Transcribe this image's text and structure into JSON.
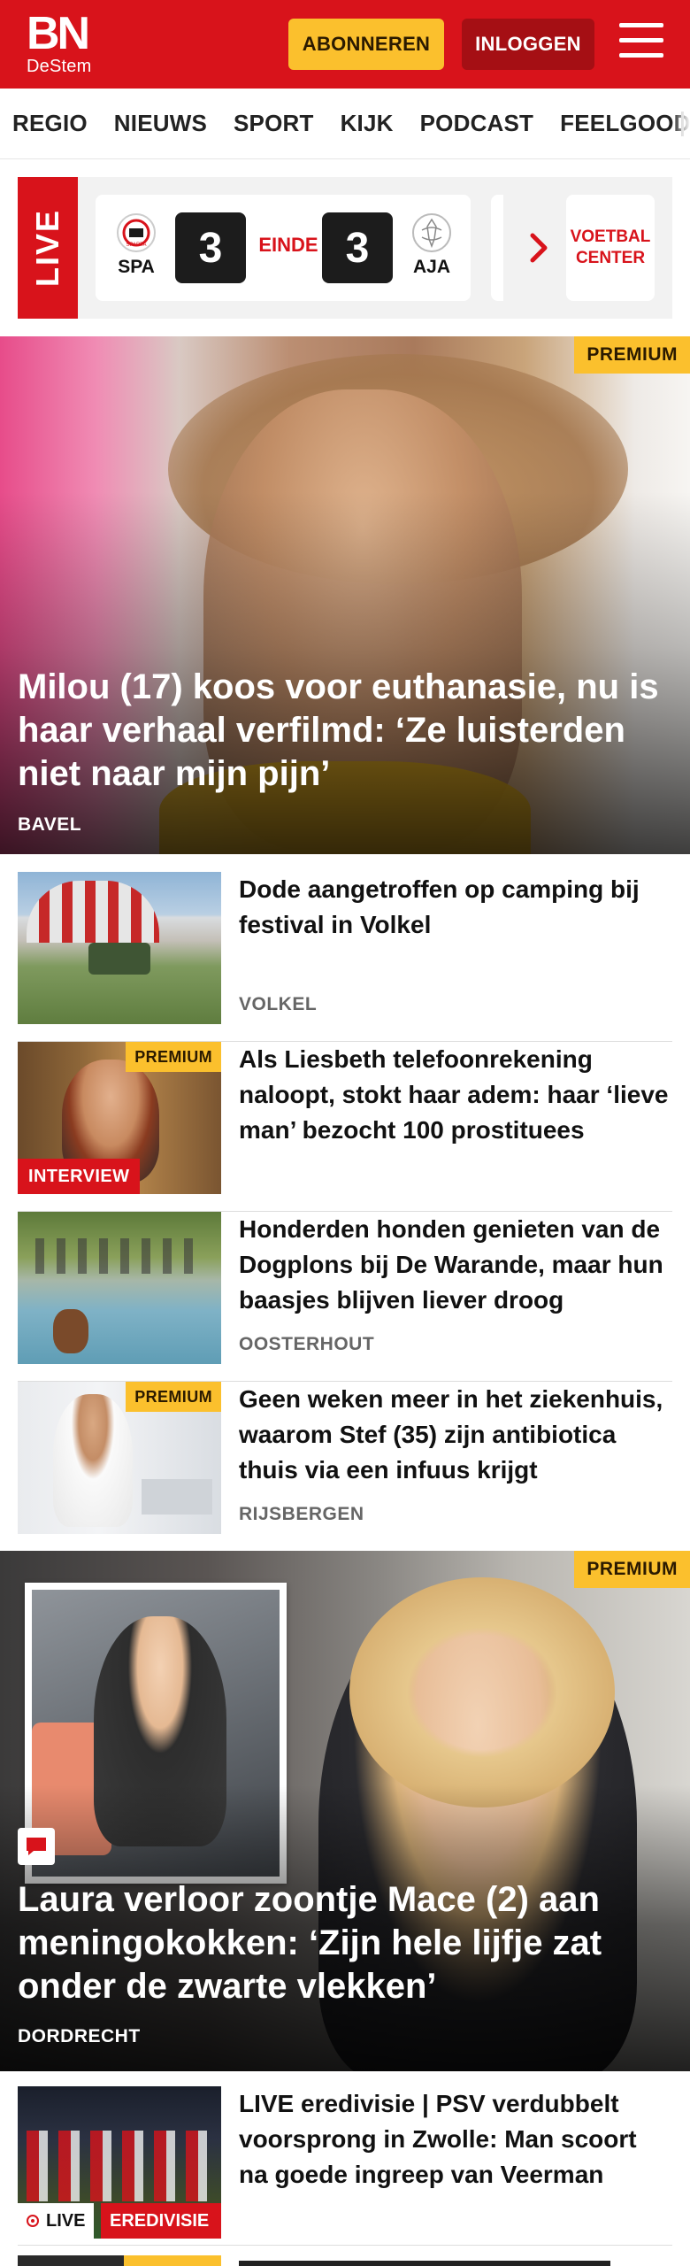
{
  "header": {
    "logo_main": "BN",
    "logo_sub": "DeStem",
    "subscribe_label": "ABONNEREN",
    "login_label": "INLOGGEN",
    "menu_icon": "hamburger-menu-icon",
    "colors": {
      "brand": "#d8131b",
      "subscribe": "#fbc02d",
      "login": "#a50f14"
    }
  },
  "nav": {
    "items": [
      "REGIO",
      "NIEUWS",
      "SPORT",
      "KIJK",
      "PODCAST",
      "FEELGOOD"
    ]
  },
  "live": {
    "label": "LIVE",
    "match": {
      "home_team": "SPA",
      "home_score": "3",
      "status": "EINDE",
      "away_score": "3",
      "away_team": "AJA"
    },
    "voetbal_center_line1": "VOETBAL",
    "voetbal_center_line2": "CENTER"
  },
  "hero": {
    "badge": "PREMIUM",
    "title": "Milou (17) koos voor euthanasie, nu is haar verhaal verfilmd: ‘Ze luisterden niet naar mijn pijn’",
    "location": "BAVEL"
  },
  "articles": [
    {
      "title": "Dode aangetroffen op camping bij festival in Volkel",
      "location": "VOLKEL",
      "badge": "",
      "label": ""
    },
    {
      "title": "Als Liesbeth telefoonrekening naloopt, stokt haar adem: haar ‘lieve man’ bezocht 100 prostituees",
      "location": "",
      "badge": "PREMIUM",
      "label": "INTERVIEW"
    },
    {
      "title": "Honderden honden genieten van de Dogplons bij De Warande, maar hun baasjes blijven liever droog",
      "location": "OOSTERHOUT",
      "badge": "",
      "label": ""
    },
    {
      "title": "Geen weken meer in het ziekenhuis, waarom Stef (35) zijn antibiotica thuis via een infuus krijgt",
      "location": "RIJSBERGEN",
      "badge": "PREMIUM",
      "label": ""
    }
  ],
  "feature2": {
    "badge": "PREMIUM",
    "title": "Laura verloor zoontje Mace (2) aan meningokokken: ‘Zijn hele lijfje zat onder de zwarte vlekken’",
    "location": "DORDRECHT",
    "comment_icon": "comment-icon"
  },
  "live_article": {
    "title": "LIVE eredivisie | PSV verdubbelt voorsprong in Zwolle: Man scoort na goede ingreep van Veerman",
    "live_label": "LIVE",
    "category": "EREDIVISIE"
  },
  "peek_article": {
    "badge": "PREMIUM"
  }
}
